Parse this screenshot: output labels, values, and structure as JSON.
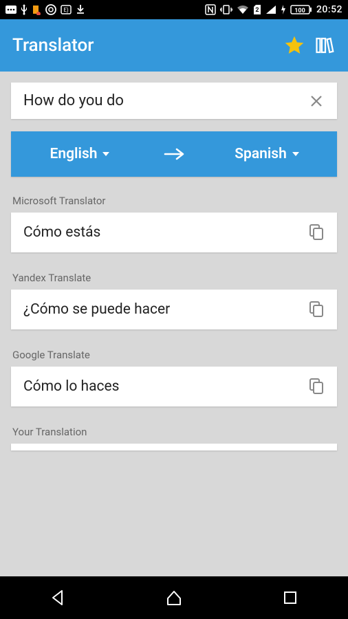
{
  "status": {
    "time": "20:52",
    "battery": "100",
    "sim": "2"
  },
  "header": {
    "title": "Translator"
  },
  "input": {
    "text": "How do you do"
  },
  "lang": {
    "source": "English",
    "target": "Spanish"
  },
  "results": [
    {
      "provider": "Microsoft Translator",
      "text": "Cómo estás"
    },
    {
      "provider": "Yandex Translate",
      "text": "¿Cómo se puede hacer"
    },
    {
      "provider": "Google Translate",
      "text": "Cómo lo haces"
    }
  ],
  "custom_label": "Your Translation"
}
